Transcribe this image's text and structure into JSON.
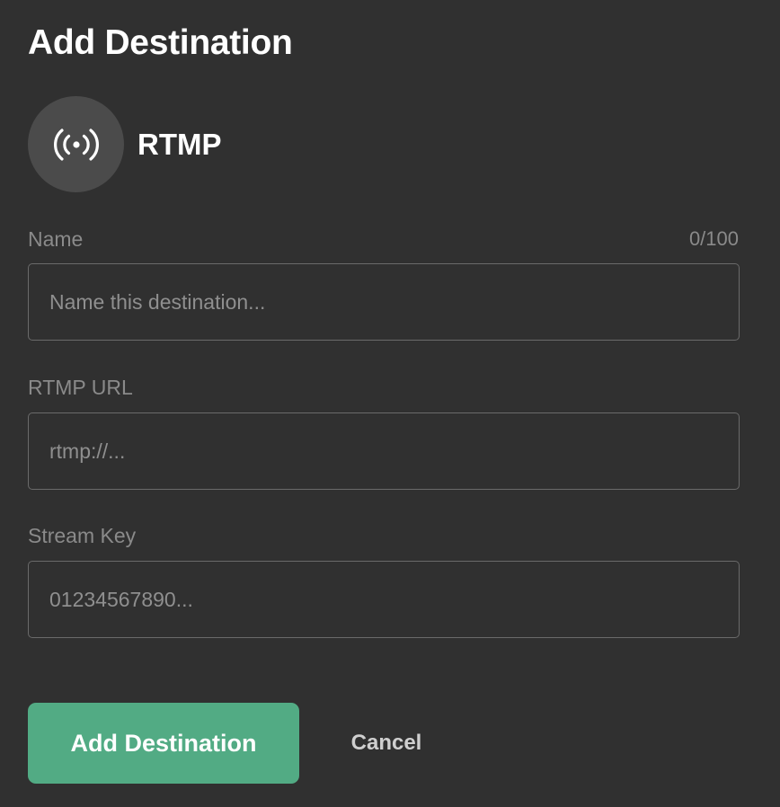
{
  "dialog": {
    "title": "Add Destination"
  },
  "platform": {
    "name": "RTMP",
    "icon": "broadcast-icon"
  },
  "fields": {
    "name": {
      "label": "Name",
      "counter": "0/100",
      "value": "",
      "placeholder": "Name this destination..."
    },
    "rtmp_url": {
      "label": "RTMP URL",
      "value": "",
      "placeholder": "rtmp://..."
    },
    "stream_key": {
      "label": "Stream Key",
      "value": "",
      "placeholder": "01234567890..."
    }
  },
  "actions": {
    "add_label": "Add Destination",
    "cancel_label": "Cancel"
  },
  "colors": {
    "background": "#303030",
    "accent": "#52ab84",
    "icon_circle": "#4b4b4b"
  }
}
